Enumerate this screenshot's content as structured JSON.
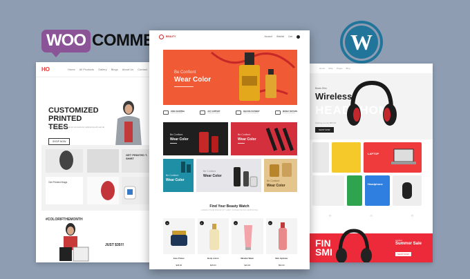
{
  "logos": {
    "woo_badge": "WOO",
    "woo_text": "COMMERCE",
    "wordpress_mark": "W"
  },
  "left_site": {
    "logo": "HO",
    "nav": [
      "Home",
      "All Products",
      "Gallery",
      "Blogs",
      "About Us",
      "Contact"
    ],
    "hero_title": "CUSTOMIZED PRINTED TEES",
    "hero_sub": "Lorem ipsum dolor sit amet consectetur adipiscing elit sed do",
    "hero_button": "SHOP NOW",
    "grid_label_1": "GET PRINTED T-SHIRT",
    "grid_label_2": "Get Printed Mugs",
    "feature_tag": "#COLORIFTHEMONTH",
    "price": "JUST $35!!!"
  },
  "right_site": {
    "nav": [
      "Home",
      "Shop",
      "Pages",
      "Blog"
    ],
    "hero_kicker": "Beats Slim",
    "hero_title": "Wireless",
    "hero_ghost": "HEADPHONE",
    "hero_sub": "Starting at only $59.00",
    "hero_button": "SHOP NOW",
    "tile_laptop": "LAPTOP",
    "tile_headphone": "Headphone",
    "sale_big_1": "FIN",
    "sale_big_2": "SMI",
    "sale_kicker": "Limited",
    "sale_title": "Summer Sale",
    "sale_button": "SHOP NOW"
  },
  "center_site": {
    "logo": "BEAUTY",
    "account_links": [
      "Account",
      "Wishlist",
      "Cart"
    ],
    "hero_kicker": "Be Confiont",
    "hero_title": "Wear Color",
    "features": [
      {
        "title": "FREE SHIPPING",
        "sub": "Orders over $100"
      },
      {
        "title": "24/7 SUPPORT",
        "sub": "Dedicated support"
      },
      {
        "title": "SECURE PAYMENT",
        "sub": "100% secure payment"
      },
      {
        "title": "MONEY RETURN",
        "sub": "30 days guarantee"
      }
    ],
    "banners": [
      {
        "kicker": "Be Confiont",
        "title": "Wear Color"
      },
      {
        "kicker": "Be Confiont",
        "title": "Wear Color"
      },
      {
        "kicker": "Be Confiont",
        "title": "Wear Color"
      },
      {
        "kicker": "Be Confiont",
        "title": "Wear Color"
      },
      {
        "kicker": "Be Confiont",
        "title": "Wear Color"
      }
    ],
    "section_title": "Find Your Beauty Watch",
    "section_sub": "LOREM IPSUM DOLOR SIT AMET CONSECTETUR ADIPISCING",
    "products": [
      {
        "name": "Face Primer",
        "price": "$38.00",
        "badge": "+"
      },
      {
        "name": "Body Lotion",
        "price": "$45.00",
        "badge": "+"
      },
      {
        "name": "Micellar Water",
        "price": "$24.00",
        "badge": "+"
      },
      {
        "name": "Skin Hydrator",
        "price": "$52.00",
        "badge": "+"
      }
    ]
  },
  "colors": {
    "woo_purple": "#8a5496",
    "wp_blue": "#21759b",
    "hero_orange": "#f05a34",
    "sale_red": "#ec2a3a",
    "background": "#8e9db2"
  }
}
